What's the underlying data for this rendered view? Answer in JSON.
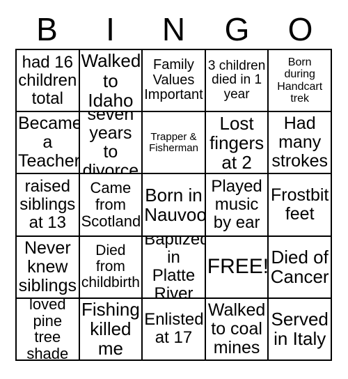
{
  "card": {
    "header_letters": [
      "B",
      "I",
      "N",
      "G",
      "O"
    ],
    "free_space_label": "FREE!",
    "colors": {
      "background": "#ffffff",
      "border": "#000000",
      "text": "#000000"
    },
    "grid": {
      "rows": 5,
      "columns": 5
    },
    "cells": [
      {
        "text": "had 16\nchildren\ntotal",
        "size": "fs-24"
      },
      {
        "text": "Walked\nto\nIdaho",
        "size": "fs-26"
      },
      {
        "text": "Family\nValues\nImportant",
        "size": "fs-20"
      },
      {
        "text": "3 children\ndied in 1\nyear",
        "size": "fs-19"
      },
      {
        "text": "Born\nduring\nHandcart\ntrek",
        "size": "fs-16"
      },
      {
        "text": "Became\na\nTeacher",
        "size": "fs-25"
      },
      {
        "text": "seven\nyears to\ndivorce",
        "size": "fs-25"
      },
      {
        "text": "Trapper &\nFisherman",
        "size": "fs-15"
      },
      {
        "text": "Lost\nfingers\nat 2",
        "size": "fs-26"
      },
      {
        "text": "Had\nmany\nstrokes",
        "size": "fs-25"
      },
      {
        "text": "raised\nsiblings\nat 13",
        "size": "fs-24"
      },
      {
        "text": "Came\nfrom\nScotland",
        "size": "fs-22"
      },
      {
        "text": "Born in\nNauvoo",
        "size": "fs-26"
      },
      {
        "text": "Played\nmusic\nby ear",
        "size": "fs-24"
      },
      {
        "text": "Frostbit\nfeet",
        "size": "fs-25"
      },
      {
        "text": "Never\nknew\nsiblings",
        "size": "fs-25"
      },
      {
        "text": "Died\nfrom\nchildbirth",
        "size": "fs-21"
      },
      {
        "text": "Baptized\nin Platte\nRiver",
        "size": "fs-24"
      },
      {
        "text": "FREE!",
        "size": "fs-30"
      },
      {
        "text": "Died of\nCancer",
        "size": "fs-26"
      },
      {
        "text": "loved\npine tree\nshade",
        "size": "fs-22"
      },
      {
        "text": "Fishing\nkilled\nme",
        "size": "fs-26"
      },
      {
        "text": "Enlisted\nat 17",
        "size": "fs-24"
      },
      {
        "text": "Walked\nto coal\nmines",
        "size": "fs-25"
      },
      {
        "text": "Served\nin Italy",
        "size": "fs-26"
      }
    ]
  }
}
